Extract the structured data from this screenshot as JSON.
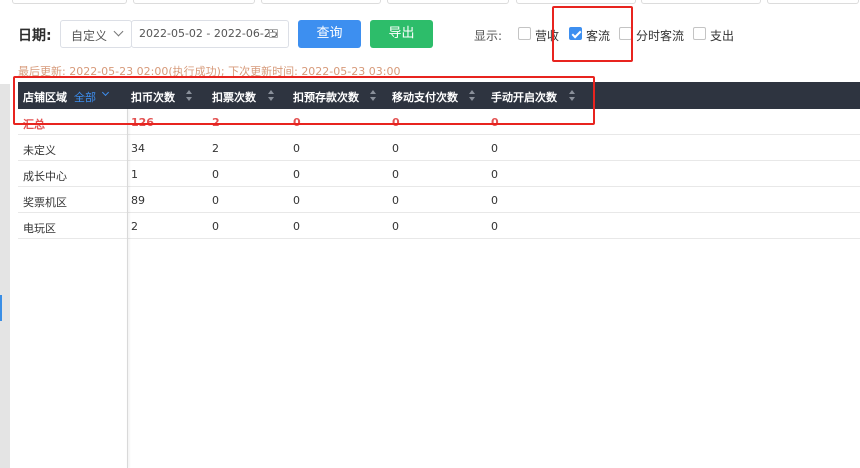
{
  "filter": {
    "date_label": "日期:",
    "range_type": "自定义",
    "date_range": "2022-05-02 - 2022-06-25",
    "query_button": "查询",
    "export_button": "导出",
    "show_label": "显示:",
    "options": [
      {
        "label": "营收",
        "checked": false
      },
      {
        "label": "客流",
        "checked": true
      },
      {
        "label": "分时客流",
        "checked": false
      },
      {
        "label": "支出",
        "checked": false
      }
    ]
  },
  "update_info": "最后更新: 2022-05-23 02:00(执行成功); 下次更新时间: 2022-05-23 03:00",
  "table": {
    "area_header": "店铺区域",
    "area_filter": "全部",
    "columns": [
      "扣币次数",
      "扣票次数",
      "扣预存款次数",
      "移动支付次数",
      "手动开启次数"
    ],
    "rows": [
      {
        "area": "汇总",
        "values": [
          "126",
          "2",
          "0",
          "0",
          "0"
        ],
        "total": true
      },
      {
        "area": "未定义",
        "values": [
          "34",
          "2",
          "0",
          "0",
          "0"
        ]
      },
      {
        "area": "成长中心",
        "values": [
          "1",
          "0",
          "0",
          "0",
          "0"
        ]
      },
      {
        "area": "奖票机区",
        "values": [
          "89",
          "0",
          "0",
          "0",
          "0"
        ]
      },
      {
        "area": "电玩区",
        "values": [
          "2",
          "0",
          "0",
          "0",
          "0"
        ]
      }
    ]
  },
  "colors": {
    "primary": "#3d8ff0",
    "export": "#2dbd6a",
    "header_bg": "#2e3440",
    "total_text": "#e35252",
    "annotation": "#e8241f"
  }
}
